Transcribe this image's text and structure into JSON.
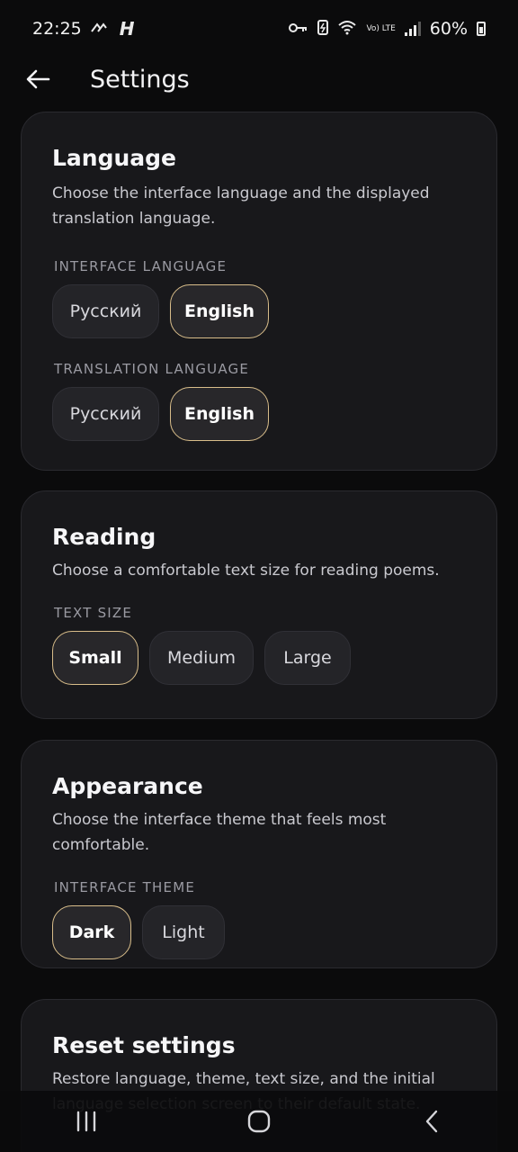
{
  "status_bar": {
    "time": "22:25",
    "network_icons": "^^ H",
    "battery_percent": "60%",
    "lte_label": "Vo) LTE"
  },
  "header": {
    "title": "Settings",
    "back_icon": "arrow-left-icon"
  },
  "language_card": {
    "title": "Language",
    "description": "Choose the interface language and the displayed translation language.",
    "interface_label": "INTERFACE LANGUAGE",
    "interface_options": [
      "Русский",
      "English"
    ],
    "interface_selected": "English",
    "translation_label": "TRANSLATION LANGUAGE",
    "translation_options": [
      "Русский",
      "English"
    ],
    "translation_selected": "English"
  },
  "reading_card": {
    "title": "Reading",
    "description": "Choose a comfortable text size for reading poems.",
    "text_size_label": "TEXT SIZE",
    "options": [
      "Small",
      "Medium",
      "Large"
    ],
    "selected": "Small"
  },
  "appearance_card": {
    "title": "Appearance",
    "description": "Choose the interface theme that feels most comfortable.",
    "theme_label": "INTERFACE THEME",
    "options": [
      "Dark",
      "Light"
    ],
    "selected": "Dark"
  },
  "reset_card": {
    "title": "Reset settings",
    "description": "Restore language, theme, text size, and the initial language selection screen to their default state."
  },
  "colors": {
    "background": "#0b0b0c",
    "card": "#18181b",
    "accent_border": "#d8bd8a"
  },
  "nav_bar": {
    "recents_icon": "recents-icon",
    "home_icon": "home-icon",
    "back_icon": "back-chevron-icon"
  }
}
